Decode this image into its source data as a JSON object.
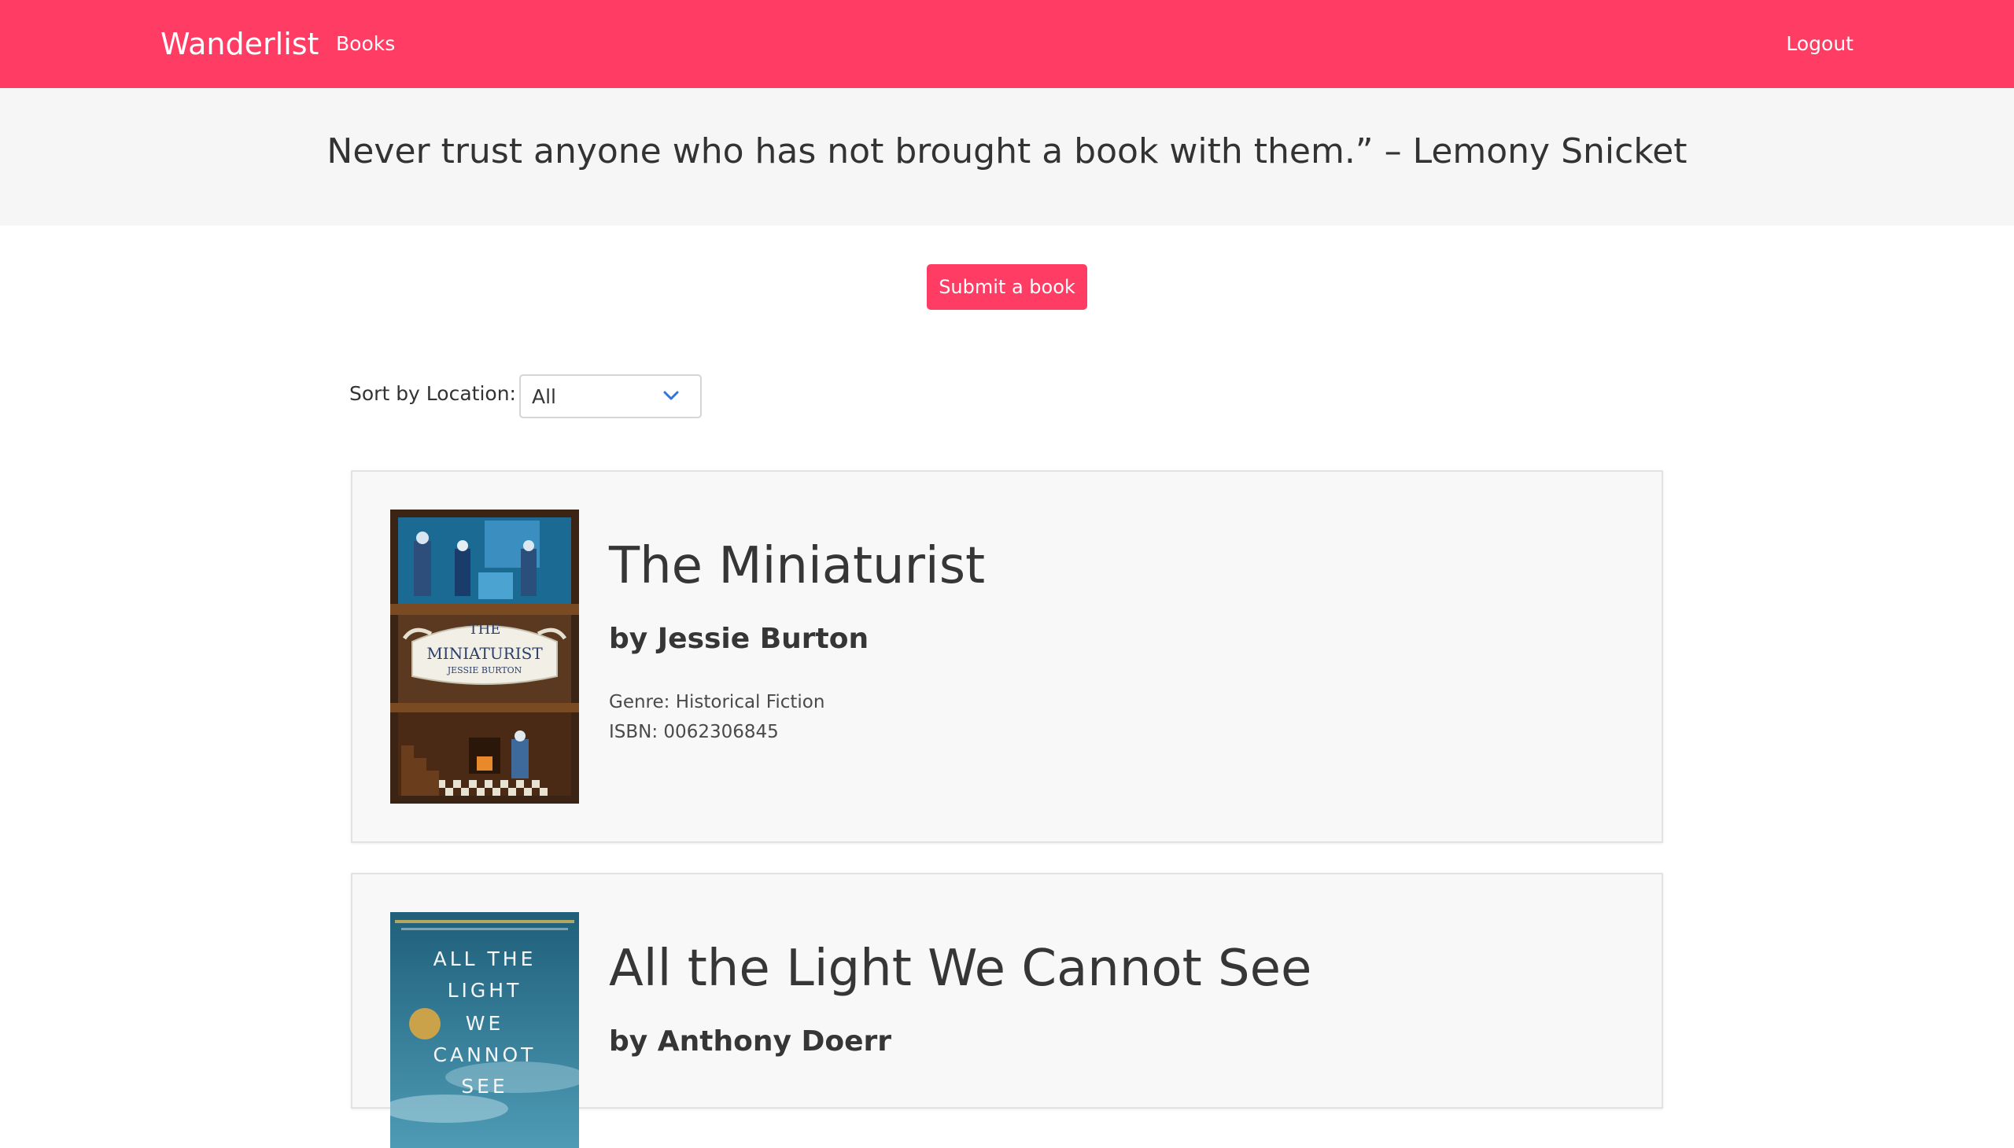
{
  "nav": {
    "brand": "Wanderlist",
    "books_link": "Books",
    "logout_link": "Logout",
    "accent_color": "#ff3d64"
  },
  "banner": {
    "quote": "Never trust anyone who has not brought a book with them.” – Lemony Snicket"
  },
  "actions": {
    "submit_label": "Submit a book"
  },
  "sort": {
    "label": "Sort by Location:",
    "selected": "All"
  },
  "books": [
    {
      "title": "The Miniaturist",
      "author": "by Jessie Burton",
      "genre": "Genre: Historical Fiction",
      "isbn": "ISBN: 0062306845",
      "cover_text": [
        "THE",
        "MINIATURIST",
        "JESSIE BURTON"
      ]
    },
    {
      "title": "All the Light We Cannot See",
      "author": "by Anthony Doerr",
      "cover_text": [
        "ALL THE",
        "LIGHT",
        "WE",
        "CANNOT",
        "SEE"
      ]
    }
  ]
}
